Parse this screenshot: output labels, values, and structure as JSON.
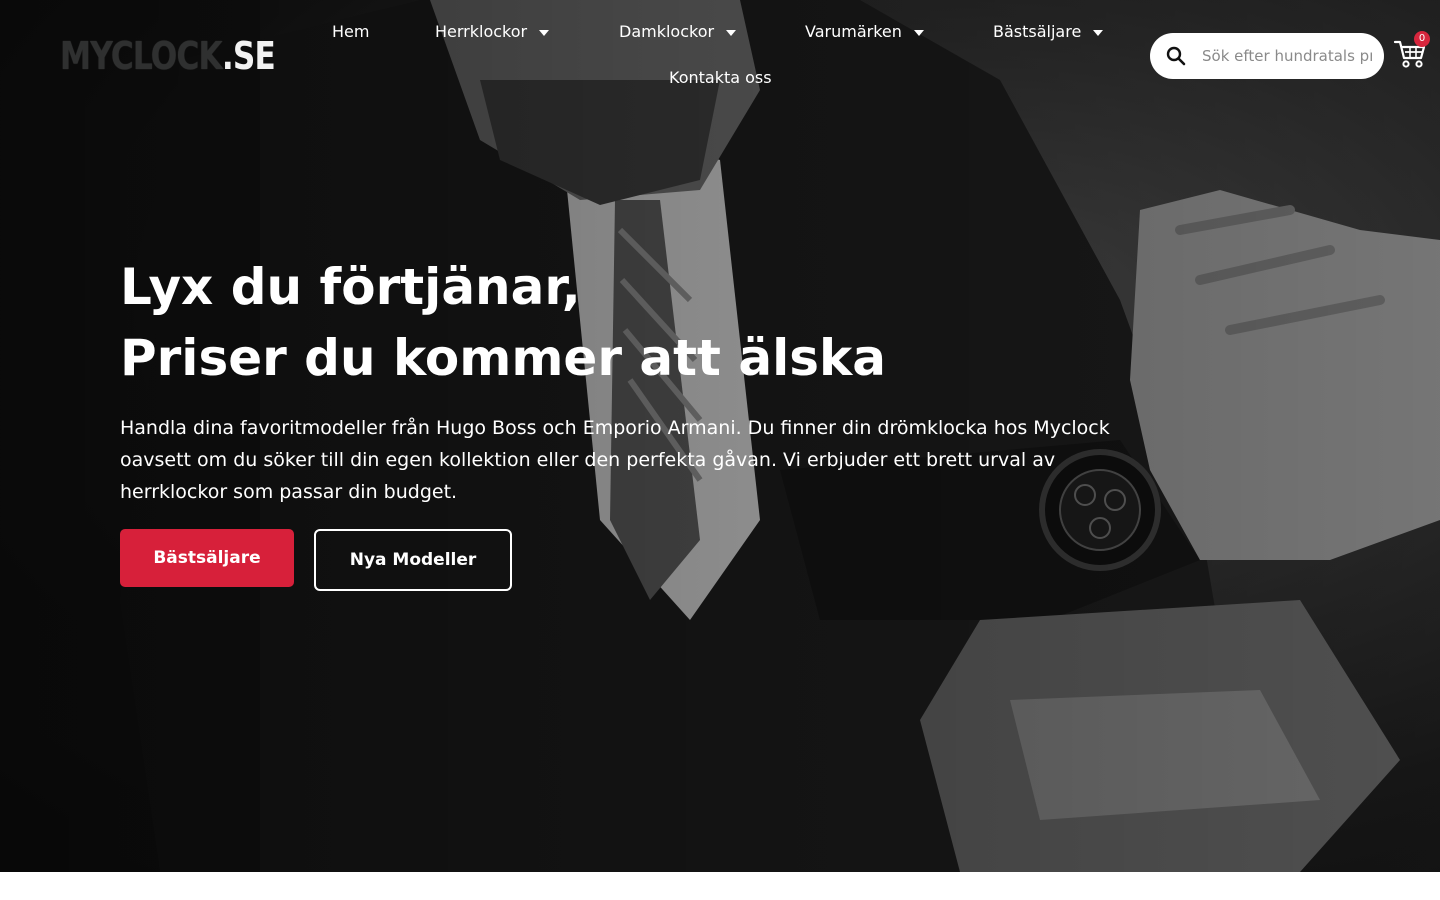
{
  "brand": {
    "logo_main": "MYCLOCK",
    "logo_tld": ".SE"
  },
  "nav": {
    "items": [
      {
        "label": "Hem",
        "has_dropdown": false
      },
      {
        "label": "Herrklockor",
        "has_dropdown": true
      },
      {
        "label": "Damklockor",
        "has_dropdown": true
      },
      {
        "label": "Varumärken",
        "has_dropdown": true
      },
      {
        "label": "Bästsäljare",
        "has_dropdown": true
      },
      {
        "label": "Kontakta oss",
        "has_dropdown": false
      }
    ]
  },
  "search": {
    "placeholder": "Sök efter hundratals produkter",
    "value": "",
    "icon": "search-icon"
  },
  "cart": {
    "icon": "cart-icon",
    "count": "0"
  },
  "hero": {
    "headline_line1": "Lyx du förtjänar,",
    "headline_line2": "Priser du kommer att älska",
    "body": "Handla dina favoritmodeller från Hugo Boss och Emporio Armani. Du finner din drömklocka hos Myclock oavsett om du söker till din egen kollektion eller den perfekta gåvan. Vi erbjuder ett brett urval av herrklockor som passar din budget.",
    "primary_button": "Bästsäljare",
    "secondary_button": "Nya Modeller"
  },
  "colors": {
    "accent": "#d7203a",
    "hero_overlay": "#1a1a1a",
    "text_on_dark": "#ffffff",
    "badge": "#d7263d"
  }
}
